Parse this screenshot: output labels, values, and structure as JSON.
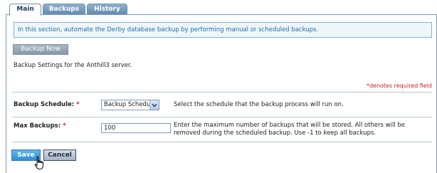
{
  "tabs": [
    {
      "label": "Main"
    },
    {
      "label": "Backups"
    },
    {
      "label": "History"
    }
  ],
  "info": {
    "text": "In this section, automate the Derby database backup by performing manual or scheduled backups."
  },
  "backup_now_label": "Backup Now",
  "settings_description": "Backup Settings for the Anthill3 server.",
  "required_note": "*denotes required field",
  "fields": {
    "schedule": {
      "label": "Backup Schedule:",
      "required_mark": "*",
      "value": "Backup Schedu",
      "help": "Select the schedule that the backup process will run on."
    },
    "max_backups": {
      "label": "Max Backups:",
      "required_mark": "*",
      "value": "100",
      "help": "Enter the maximum number of backups that will be stored. All others will be removed during the scheduled backup. Use -1 to keep all backups."
    }
  },
  "buttons": {
    "save": "Save",
    "cancel": "Cancel"
  },
  "icons": {
    "dropdown": "chevron-down-icon",
    "cursor": "hand-pointer-icon"
  },
  "colors": {
    "tab_active_text": "#1d3d63",
    "info_text": "#1d6fa8",
    "required_red": "#d01d1d",
    "save_blue": "#2f8fd5"
  }
}
